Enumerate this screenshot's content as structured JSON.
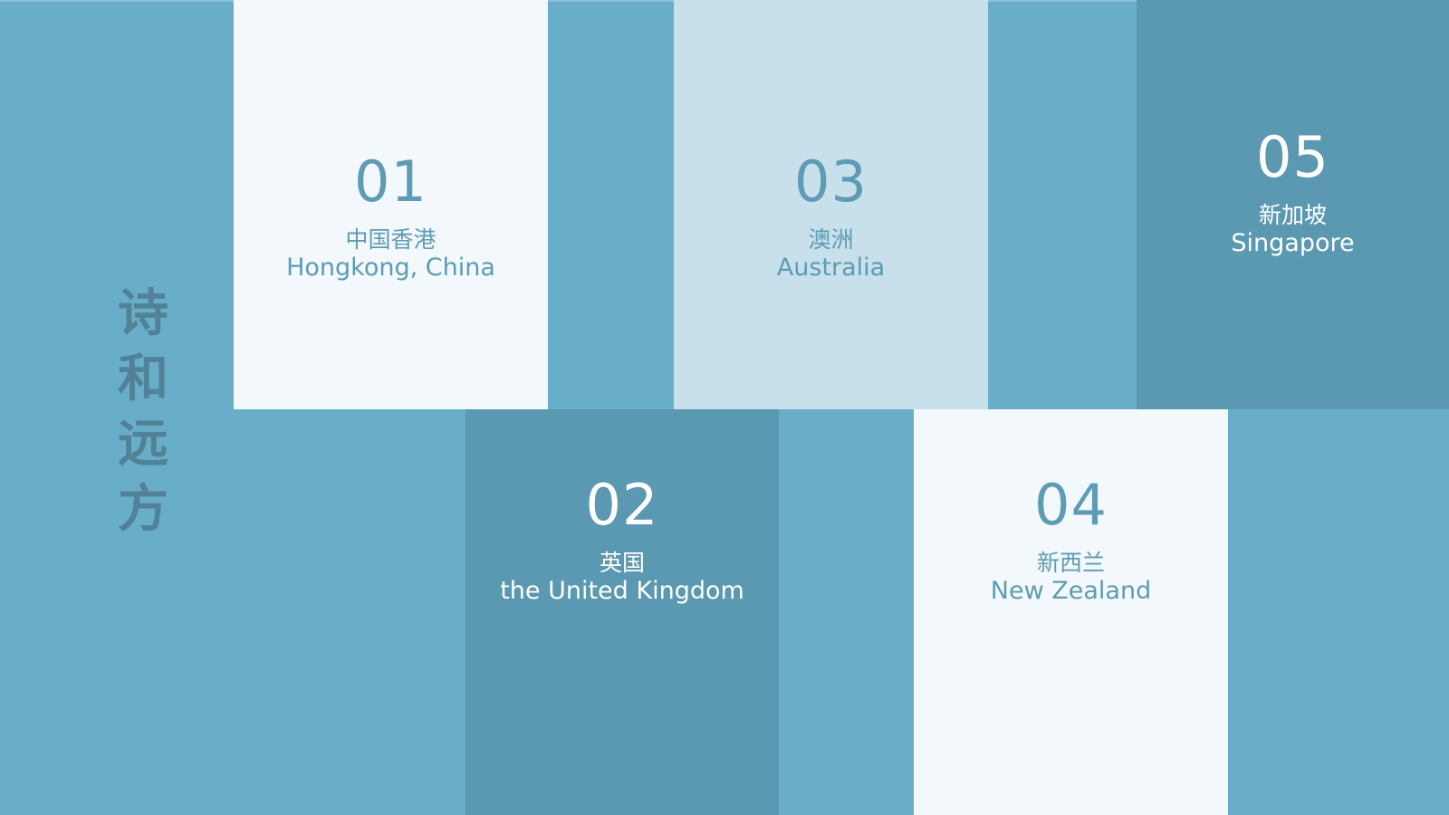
{
  "title_chars": [
    "诗",
    "和",
    "远",
    "方"
  ],
  "cards": [
    {
      "number": "01",
      "cn": "中国香港",
      "en": "Hongkong, China"
    },
    {
      "number": "02",
      "cn": "英国",
      "en": "the United Kingdom"
    },
    {
      "number": "03",
      "cn": "澳洲",
      "en": "Australia"
    },
    {
      "number": "04",
      "cn": "新西兰",
      "en": "New Zealand"
    },
    {
      "number": "05",
      "cn": "新加坡",
      "en": "Singapore"
    }
  ],
  "colors": {
    "background": "#69aec8",
    "light_card": "#f2f8fb",
    "pale_card": "#c7e0eb",
    "dark_card": "#5b98b1",
    "accent_text": "#5d9cb4",
    "title_text": "#4f7f95"
  }
}
